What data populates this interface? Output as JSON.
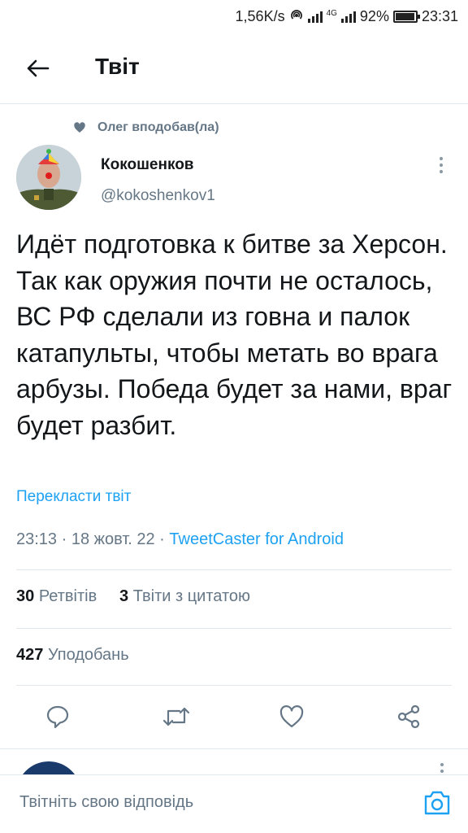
{
  "status_bar": {
    "net_speed": "1,56K/s",
    "network_type": "4G",
    "battery": "92%",
    "time": "23:31"
  },
  "header": {
    "title": "Твіт",
    "back_icon": "arrow-left-icon"
  },
  "social_context": {
    "icon": "heart-icon",
    "text": "Олег вподобав(ла)"
  },
  "tweet": {
    "author_name": "Кокошенков",
    "author_handle": "@kokoshenkov1",
    "text": "Идёт подготовка к битве за Херсон. Так как оружия почти не осталось, ВС РФ сделали из говна и палок катапульты, чтобы метать во врага арбузы. Победа будет за нами, враг будет разбит.",
    "translate_label": "Перекласти твіт",
    "timestamp": "23:13 · 18 жовт. 22 · ",
    "source": "TweetCaster for Android"
  },
  "stats": {
    "retweets_count": "30",
    "retweets_label": "Ретвітів",
    "quotes_count": "3",
    "quotes_label": "Твіти з цитатою",
    "likes_count": "427",
    "likes_label": "Уподобань"
  },
  "actions": {
    "reply_icon": "reply-icon",
    "retweet_icon": "retweet-icon",
    "like_icon": "heart-icon",
    "share_icon": "share-icon"
  },
  "reply_bar": {
    "placeholder": "Твітніть свою відповідь",
    "camera_icon": "camera-icon"
  },
  "colors": {
    "accent": "#1da1f2",
    "secondary_text": "#657786",
    "primary_text": "#14171a",
    "divider": "#e1e8ed"
  }
}
